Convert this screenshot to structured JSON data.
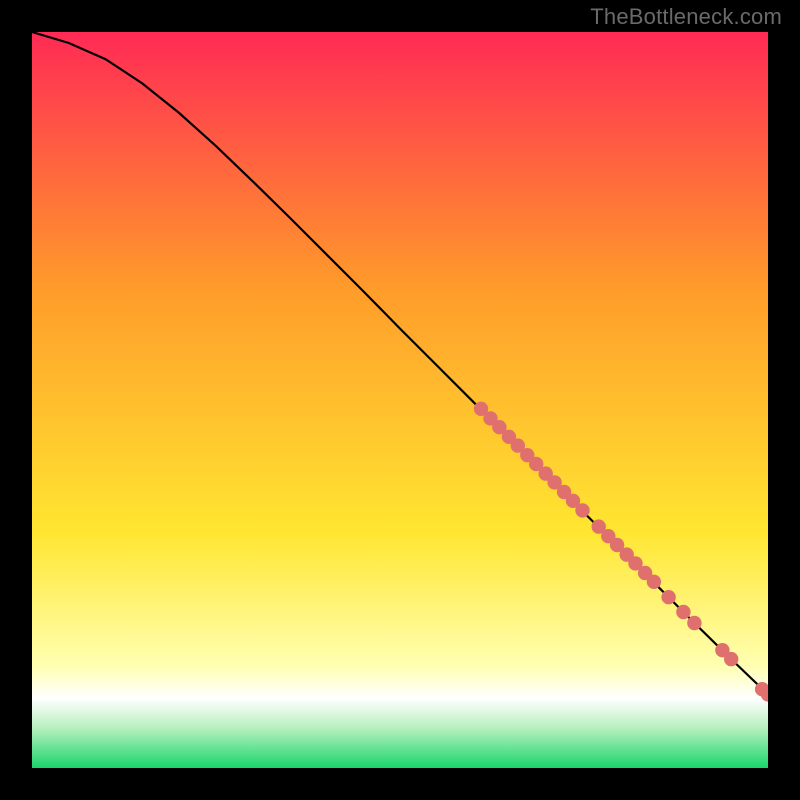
{
  "watermark": "TheBottleneck.com",
  "colors": {
    "pink": "#ff2a55",
    "orange": "#ff9c2a",
    "yellow": "#ffe631",
    "pale_yellow": "#ffffb0",
    "white": "#ffffff",
    "light_green": "#b8f0c0",
    "green": "#1ad66a",
    "dot": "#e0706e",
    "line": "#000000",
    "frame": "#000000"
  },
  "chart_data": {
    "type": "line",
    "title": "",
    "xlabel": "",
    "ylabel": "",
    "xlim": [
      0,
      100
    ],
    "ylim": [
      0,
      100
    ],
    "note": "Axes have no tick labels in the source image; values are estimated proportionally from pixel positions on a 0–100 scale for both axes.",
    "curve": [
      {
        "x": 0,
        "y": 100
      },
      {
        "x": 5,
        "y": 98.5
      },
      {
        "x": 10,
        "y": 96.3
      },
      {
        "x": 15,
        "y": 93.0
      },
      {
        "x": 20,
        "y": 89.0
      },
      {
        "x": 25,
        "y": 84.5
      },
      {
        "x": 30,
        "y": 79.7
      },
      {
        "x": 35,
        "y": 74.8
      },
      {
        "x": 40,
        "y": 69.8
      },
      {
        "x": 45,
        "y": 64.8
      },
      {
        "x": 50,
        "y": 59.7
      },
      {
        "x": 55,
        "y": 54.7
      },
      {
        "x": 60,
        "y": 49.7
      },
      {
        "x": 65,
        "y": 44.7
      },
      {
        "x": 70,
        "y": 39.7
      },
      {
        "x": 75,
        "y": 34.7
      },
      {
        "x": 80,
        "y": 29.7
      },
      {
        "x": 85,
        "y": 24.7
      },
      {
        "x": 90,
        "y": 19.7
      },
      {
        "x": 95,
        "y": 14.8
      },
      {
        "x": 100,
        "y": 10.0
      }
    ],
    "dots": [
      {
        "x": 61.0,
        "y": 48.8
      },
      {
        "x": 62.3,
        "y": 47.5
      },
      {
        "x": 63.5,
        "y": 46.3
      },
      {
        "x": 64.8,
        "y": 45.0
      },
      {
        "x": 66.0,
        "y": 43.8
      },
      {
        "x": 67.3,
        "y": 42.5
      },
      {
        "x": 68.5,
        "y": 41.3
      },
      {
        "x": 69.8,
        "y": 40.0
      },
      {
        "x": 71.0,
        "y": 38.8
      },
      {
        "x": 72.3,
        "y": 37.5
      },
      {
        "x": 73.5,
        "y": 36.3
      },
      {
        "x": 74.8,
        "y": 35.0
      },
      {
        "x": 77.0,
        "y": 32.8
      },
      {
        "x": 78.3,
        "y": 31.5
      },
      {
        "x": 79.5,
        "y": 30.3
      },
      {
        "x": 80.8,
        "y": 29.0
      },
      {
        "x": 82.0,
        "y": 27.8
      },
      {
        "x": 83.3,
        "y": 26.5
      },
      {
        "x": 84.5,
        "y": 25.3
      },
      {
        "x": 86.5,
        "y": 23.2
      },
      {
        "x": 88.5,
        "y": 21.2
      },
      {
        "x": 90.0,
        "y": 19.7
      },
      {
        "x": 93.8,
        "y": 16.0
      },
      {
        "x": 95.0,
        "y": 14.8
      },
      {
        "x": 99.2,
        "y": 10.7
      },
      {
        "x": 100.0,
        "y": 10.0
      }
    ],
    "gradient_stops": [
      {
        "pos": 0.0,
        "color": "#ff2a55"
      },
      {
        "pos": 0.35,
        "color": "#ff9c2a"
      },
      {
        "pos": 0.68,
        "color": "#ffe631"
      },
      {
        "pos": 0.86,
        "color": "#ffffb0"
      },
      {
        "pos": 0.905,
        "color": "#ffffff"
      },
      {
        "pos": 0.945,
        "color": "#b8f0c0"
      },
      {
        "pos": 1.0,
        "color": "#1ad66a"
      }
    ]
  }
}
